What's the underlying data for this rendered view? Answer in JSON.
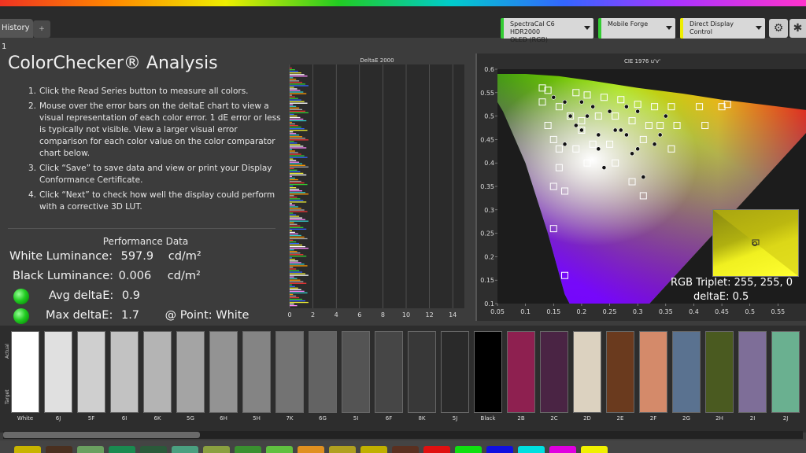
{
  "tabs": {
    "history": "History 1",
    "add": "+"
  },
  "dropdowns": [
    {
      "line1": "SpectraCal C6 HDR2000",
      "line2": "OLED (RGB)"
    },
    {
      "line1": "Mobile Forge",
      "line2": ""
    },
    {
      "line1": "Direct Display Control",
      "line2": ""
    }
  ],
  "page_title": "ColorChecker® Analysis",
  "instructions": [
    {
      "num": "1.",
      "text": "Click the Read Series button to measure all colors."
    },
    {
      "num": "2.",
      "text": "Mouse over the error bars on the deltaE chart to view a visual representation of each color error. 1 dE error or less is typically not visible. View a larger visual error comparison for each color value on the color comparator chart below."
    },
    {
      "num": "3.",
      "text": "Click “Save” to save data and view or print your Display Conformance Certificate."
    },
    {
      "num": "4.",
      "text": "Click “Next” to check how well the display could perform with a corrective 3D LUT."
    }
  ],
  "performance": {
    "title": "Performance Data",
    "white_label": "White Luminance:",
    "white_value": "597.9",
    "white_unit": "cd/m²",
    "black_label": "Black Luminance:",
    "black_value": "0.006",
    "black_unit": "cd/m²",
    "avg_label": "Avg deltaE:",
    "avg_value": "0.9",
    "max_label": "Max deltaE:",
    "max_value": "1.7",
    "point_label": "@ Point: White"
  },
  "deltae_chart": {
    "title": "DeltaE 2000",
    "xticks": [
      "0",
      "2",
      "4",
      "6",
      "8",
      "10",
      "12",
      "14"
    ],
    "xlim": [
      0,
      15
    ]
  },
  "chart_data": {
    "type": "scatter",
    "title": "CIE 1976 u'v'",
    "xlim": [
      0.05,
      0.6
    ],
    "ylim": [
      0.1,
      0.6
    ],
    "xticks": [
      "0.05",
      "0.1",
      "0.15",
      "0.2",
      "0.25",
      "0.3",
      "0.35",
      "0.4",
      "0.45",
      "0.5",
      "0.55"
    ],
    "yticks": [
      "0.1",
      "0.15",
      "0.2",
      "0.25",
      "0.3",
      "0.35",
      "0.4",
      "0.45",
      "0.5",
      "0.55",
      "0.6"
    ],
    "targets": [
      [
        0.13,
        0.56
      ],
      [
        0.14,
        0.555
      ],
      [
        0.19,
        0.55
      ],
      [
        0.21,
        0.545
      ],
      [
        0.24,
        0.54
      ],
      [
        0.27,
        0.535
      ],
      [
        0.3,
        0.525
      ],
      [
        0.33,
        0.52
      ],
      [
        0.36,
        0.52
      ],
      [
        0.41,
        0.52
      ],
      [
        0.45,
        0.52
      ],
      [
        0.46,
        0.525
      ],
      [
        0.13,
        0.53
      ],
      [
        0.16,
        0.52
      ],
      [
        0.18,
        0.5
      ],
      [
        0.2,
        0.49
      ],
      [
        0.23,
        0.5
      ],
      [
        0.26,
        0.5
      ],
      [
        0.29,
        0.49
      ],
      [
        0.32,
        0.48
      ],
      [
        0.34,
        0.48
      ],
      [
        0.37,
        0.48
      ],
      [
        0.42,
        0.48
      ],
      [
        0.14,
        0.48
      ],
      [
        0.15,
        0.45
      ],
      [
        0.16,
        0.43
      ],
      [
        0.19,
        0.43
      ],
      [
        0.22,
        0.44
      ],
      [
        0.25,
        0.44
      ],
      [
        0.31,
        0.45
      ],
      [
        0.36,
        0.43
      ],
      [
        0.16,
        0.39
      ],
      [
        0.21,
        0.4
      ],
      [
        0.15,
        0.35
      ],
      [
        0.17,
        0.34
      ],
      [
        0.26,
        0.4
      ],
      [
        0.29,
        0.36
      ],
      [
        0.31,
        0.33
      ],
      [
        0.2,
        0.47
      ],
      [
        0.15,
        0.26
      ],
      [
        0.17,
        0.16
      ]
    ],
    "measured": [
      [
        0.15,
        0.54
      ],
      [
        0.17,
        0.53
      ],
      [
        0.2,
        0.53
      ],
      [
        0.22,
        0.52
      ],
      [
        0.25,
        0.51
      ],
      [
        0.28,
        0.52
      ],
      [
        0.3,
        0.51
      ],
      [
        0.19,
        0.48
      ],
      [
        0.2,
        0.47
      ],
      [
        0.23,
        0.46
      ],
      [
        0.28,
        0.46
      ],
      [
        0.26,
        0.47
      ],
      [
        0.3,
        0.43
      ],
      [
        0.33,
        0.44
      ],
      [
        0.29,
        0.42
      ],
      [
        0.23,
        0.43
      ],
      [
        0.17,
        0.44
      ],
      [
        0.24,
        0.39
      ],
      [
        0.31,
        0.37
      ],
      [
        0.35,
        0.5
      ],
      [
        0.18,
        0.5
      ],
      [
        0.27,
        0.47
      ],
      [
        0.21,
        0.5
      ],
      [
        0.34,
        0.46
      ]
    ],
    "selected": {
      "rgb_label": "RGB Triplet: 255, 255, 0",
      "de_label": "deltaE: 0.5"
    }
  },
  "patches": [
    {
      "label": "White",
      "actual": "#ffffff",
      "target": "#ffffff"
    },
    {
      "label": "6J",
      "actual": "#e0e0e0",
      "target": "#e0e0e0"
    },
    {
      "label": "5F",
      "actual": "#cfcfcf",
      "target": "#cfcfcf"
    },
    {
      "label": "6I",
      "actual": "#c2c2c2",
      "target": "#c2c2c2"
    },
    {
      "label": "6K",
      "actual": "#b4b4b4",
      "target": "#b4b4b4"
    },
    {
      "label": "5G",
      "actual": "#a4a4a4",
      "target": "#a4a4a4"
    },
    {
      "label": "6H",
      "actual": "#939393",
      "target": "#939393"
    },
    {
      "label": "5H",
      "actual": "#848484",
      "target": "#848484"
    },
    {
      "label": "7K",
      "actual": "#737373",
      "target": "#737373"
    },
    {
      "label": "6G",
      "actual": "#636363",
      "target": "#636363"
    },
    {
      "label": "5I",
      "actual": "#545454",
      "target": "#545454"
    },
    {
      "label": "6F",
      "actual": "#464646",
      "target": "#464646"
    },
    {
      "label": "8K",
      "actual": "#383838",
      "target": "#383838"
    },
    {
      "label": "5J",
      "actual": "#2a2a2a",
      "target": "#2a2a2a"
    },
    {
      "label": "Black",
      "actual": "#000000",
      "target": "#000000"
    },
    {
      "label": "2B",
      "actual": "#8e2050",
      "target": "#8e2050"
    },
    {
      "label": "2C",
      "actual": "#4a2444",
      "target": "#4a2444"
    },
    {
      "label": "2D",
      "actual": "#dcd2c0",
      "target": "#dcd2c0"
    },
    {
      "label": "2E",
      "actual": "#6a3a1e",
      "target": "#6a3a1e"
    },
    {
      "label": "2F",
      "actual": "#d48a6a",
      "target": "#d48a6a"
    },
    {
      "label": "2G",
      "actual": "#5a7290",
      "target": "#5a7290"
    },
    {
      "label": "2H",
      "actual": "#4a5a20",
      "target": "#4a5a20"
    },
    {
      "label": "2I",
      "actual": "#7e6e98",
      "target": "#7e6e98"
    },
    {
      "label": "2J",
      "actual": "#6ab090",
      "target": "#6ab090"
    }
  ],
  "side_labels": {
    "actual": "Actual",
    "target": "Target"
  },
  "bottom_chips": [
    "#c8b400",
    "#4a3020",
    "#6aa060",
    "#1a8a50",
    "#2a5a3a",
    "#4aa080",
    "#8aa040",
    "#3a9030",
    "#60c040",
    "#e09020",
    "#b0a020",
    "#c0b000",
    "#5a3020",
    "#e01010",
    "#10e010",
    "#1010e0",
    "#00e0e0",
    "#e000e0",
    "#f0f000"
  ]
}
